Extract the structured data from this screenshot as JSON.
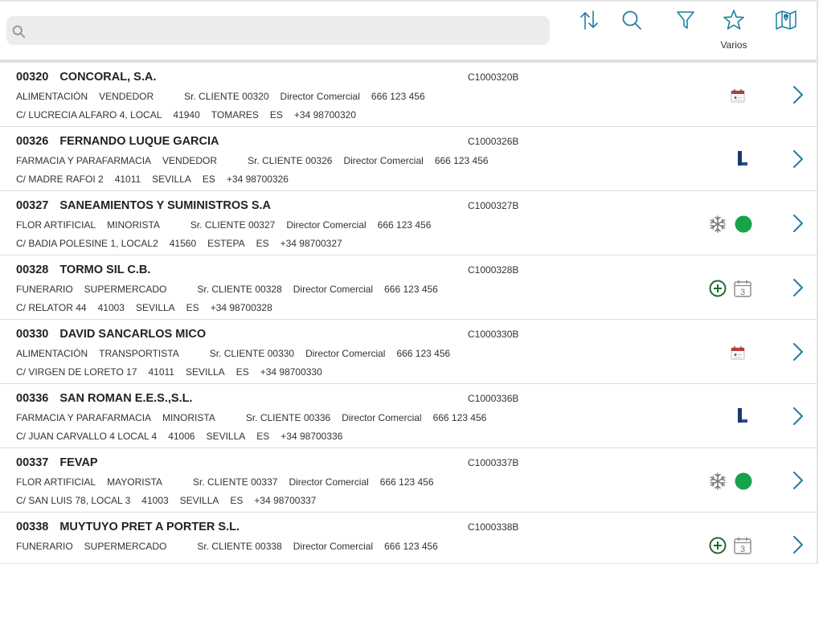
{
  "search": {
    "placeholder": "",
    "value": ""
  },
  "toolbar": {
    "varios_label": "Varios"
  },
  "colors": {
    "accent": "#1f7ea3",
    "green_dot": "#17a34a",
    "dark_green": "#1e6b2e",
    "logo_blue": "#1c3670",
    "calendar_red": "#c23a3a"
  },
  "customers": [
    {
      "id": "00320",
      "name": "CONCORAL, S.A.",
      "code": "C1000320B",
      "sector": "ALIMENTACIÓN",
      "type": "VENDEDOR",
      "contact": "Sr. CLIENTE 00320",
      "role": "Director Comercial",
      "phone": "666 123 456",
      "address": "C/ LUCRECIA ALFARO 4,  LOCAL",
      "zip": "41940",
      "city": "TOMARES",
      "country": "ES",
      "tel": "+34 98700320",
      "icons": [
        "calendar-red-icon"
      ]
    },
    {
      "id": "00326",
      "name": "FERNANDO LUQUE GARCIA",
      "code": "C1000326B",
      "sector": "FARMACIA Y PARAFARMACIA",
      "type": "VENDEDOR",
      "contact": "Sr. CLIENTE 00326",
      "role": "Director Comercial",
      "phone": "666 123 456",
      "address": "C/ MADRE RAFOI 2",
      "zip": "41011",
      "city": "SEVILLA",
      "country": "ES",
      "tel": "+34 98700326",
      "icons": [
        "l-logo-icon"
      ]
    },
    {
      "id": "00327",
      "name": "SANEAMIENTOS Y SUMINISTROS S.A",
      "code": "C1000327B",
      "sector": "FLOR ARTIFICIAL",
      "type": "MINORISTA",
      "contact": "Sr. CLIENTE 00327",
      "role": "Director Comercial",
      "phone": "666 123 456",
      "address": "C/ BADIA POLESINE 1, LOCAL2",
      "zip": "41560",
      "city": "ESTEPA",
      "country": "ES",
      "tel": "+34 98700327",
      "icons": [
        "snowflake-icon",
        "green-dot-icon"
      ]
    },
    {
      "id": "00328",
      "name": "TORMO SIL C.B.",
      "code": "C1000328B",
      "sector": "FUNERARIO",
      "type": "SUPERMERCADO",
      "contact": "Sr. CLIENTE 00328",
      "role": "Director Comercial",
      "phone": "666 123 456",
      "address": "C/ RELATOR 44",
      "zip": "41003",
      "city": "SEVILLA",
      "country": "ES",
      "tel": "+34 98700328",
      "icons": [
        "plus-circle-icon",
        "calendar-3-icon"
      ]
    },
    {
      "id": "00330",
      "name": "DAVID SANCARLOS MICO",
      "code": "C1000330B",
      "sector": "ALIMENTACIÓN",
      "type": "TRANSPORTISTA",
      "contact": "Sr. CLIENTE 00330",
      "role": "Director Comercial",
      "phone": "666 123 456",
      "address": "C/ VIRGEN DE LORETO 17",
      "zip": "41011",
      "city": "SEVILLA",
      "country": "ES",
      "tel": "+34 98700330",
      "icons": [
        "calendar-red-icon"
      ]
    },
    {
      "id": "00336",
      "name": "SAN ROMAN E.E.S.,S.L.",
      "code": "C1000336B",
      "sector": "FARMACIA Y PARAFARMACIA",
      "type": "MINORISTA",
      "contact": "Sr. CLIENTE 00336",
      "role": "Director Comercial",
      "phone": "666 123 456",
      "address": "C/ JUAN CARVALLO 4 LOCAL 4",
      "zip": "41006",
      "city": "SEVILLA",
      "country": "ES",
      "tel": "+34 98700336",
      "icons": [
        "l-logo-icon"
      ]
    },
    {
      "id": "00337",
      "name": "FEVAP",
      "code": "C1000337B",
      "sector": "FLOR ARTIFICIAL",
      "type": "MAYORISTA",
      "contact": "Sr. CLIENTE 00337",
      "role": "Director Comercial",
      "phone": "666 123 456",
      "address": "C/ SAN LUIS 78, LOCAL 3",
      "zip": "41003",
      "city": "SEVILLA",
      "country": "ES",
      "tel": "+34 98700337",
      "icons": [
        "snowflake-icon",
        "green-dot-icon"
      ]
    },
    {
      "id": "00338",
      "name": "MUYTUYO PRET A PORTER S.L.",
      "code": "C1000338B",
      "sector": "FUNERARIO",
      "type": "SUPERMERCADO",
      "contact": "Sr. CLIENTE 00338",
      "role": "Director Comercial",
      "phone": "666 123 456",
      "address": "",
      "zip": "",
      "city": "",
      "country": "",
      "tel": "",
      "icons": [
        "plus-circle-icon",
        "calendar-3-icon"
      ]
    }
  ]
}
